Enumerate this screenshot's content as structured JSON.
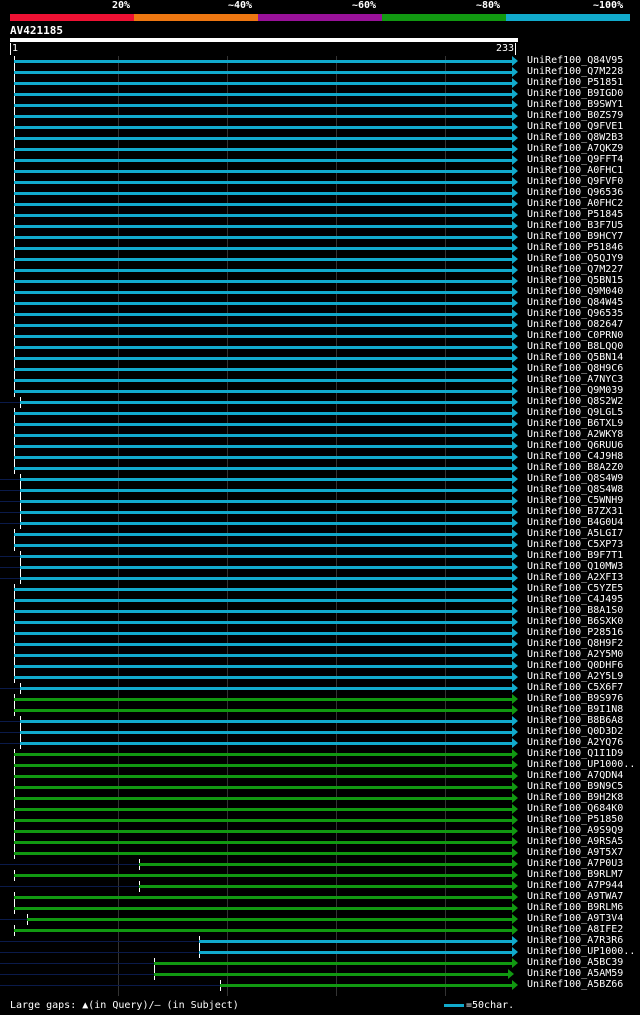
{
  "legend": {
    "labels": [
      "20%",
      "~40%",
      "~60%",
      "~80%",
      "~100%"
    ],
    "colors": [
      "#ee1133",
      "#ee7711",
      "#991199",
      "#119911",
      "#11aacc"
    ]
  },
  "query": {
    "title": "AV421185",
    "start": "1",
    "end": "233"
  },
  "hits": [
    {
      "name": "UniRef100_Q84V95",
      "color": "#11aacc",
      "start": 1,
      "end": 233
    },
    {
      "name": "UniRef100_Q7M228",
      "color": "#11aacc",
      "start": 1,
      "end": 233
    },
    {
      "name": "UniRef100_P51851",
      "color": "#11aacc",
      "start": 1,
      "end": 233
    },
    {
      "name": "UniRef100_B9IGD0",
      "color": "#11aacc",
      "start": 1,
      "end": 233
    },
    {
      "name": "UniRef100_B9SWY1",
      "color": "#11aacc",
      "start": 1,
      "end": 233
    },
    {
      "name": "UniRef100_B0ZS79",
      "color": "#11aacc",
      "start": 1,
      "end": 233
    },
    {
      "name": "UniRef100_Q9FVE1",
      "color": "#11aacc",
      "start": 1,
      "end": 233
    },
    {
      "name": "UniRef100_Q8W2B3",
      "color": "#11aacc",
      "start": 1,
      "end": 233
    },
    {
      "name": "UniRef100_A7QKZ9",
      "color": "#11aacc",
      "start": 1,
      "end": 233
    },
    {
      "name": "UniRef100_Q9FFT4",
      "color": "#11aacc",
      "start": 1,
      "end": 233
    },
    {
      "name": "UniRef100_A0FHC1",
      "color": "#11aacc",
      "start": 1,
      "end": 233
    },
    {
      "name": "UniRef100_Q9FVF0",
      "color": "#11aacc",
      "start": 1,
      "end": 233
    },
    {
      "name": "UniRef100_Q96536",
      "color": "#11aacc",
      "start": 1,
      "end": 233
    },
    {
      "name": "UniRef100_A0FHC2",
      "color": "#11aacc",
      "start": 1,
      "end": 233
    },
    {
      "name": "UniRef100_P51845",
      "color": "#11aacc",
      "start": 1,
      "end": 233
    },
    {
      "name": "UniRef100_B3F7U5",
      "color": "#11aacc",
      "start": 1,
      "end": 233
    },
    {
      "name": "UniRef100_B9HCY7",
      "color": "#11aacc",
      "start": 1,
      "end": 233
    },
    {
      "name": "UniRef100_P51846",
      "color": "#11aacc",
      "start": 1,
      "end": 233
    },
    {
      "name": "UniRef100_Q5QJY9",
      "color": "#11aacc",
      "start": 1,
      "end": 233
    },
    {
      "name": "UniRef100_Q7M227",
      "color": "#11aacc",
      "start": 1,
      "end": 233
    },
    {
      "name": "UniRef100_Q5BN15",
      "color": "#11aacc",
      "start": 1,
      "end": 233
    },
    {
      "name": "UniRef100_Q9M040",
      "color": "#11aacc",
      "start": 1,
      "end": 233
    },
    {
      "name": "UniRef100_Q84W45",
      "color": "#11aacc",
      "start": 1,
      "end": 233
    },
    {
      "name": "UniRef100_Q96535",
      "color": "#11aacc",
      "start": 1,
      "end": 233
    },
    {
      "name": "UniRef100_O82647",
      "color": "#11aacc",
      "start": 1,
      "end": 233
    },
    {
      "name": "UniRef100_C0PRN0",
      "color": "#11aacc",
      "start": 1,
      "end": 233
    },
    {
      "name": "UniRef100_B8LQQ0",
      "color": "#11aacc",
      "start": 1,
      "end": 233
    },
    {
      "name": "UniRef100_Q5BN14",
      "color": "#11aacc",
      "start": 1,
      "end": 233
    },
    {
      "name": "UniRef100_Q8H9C6",
      "color": "#11aacc",
      "start": 1,
      "end": 233
    },
    {
      "name": "UniRef100_A7NYC3",
      "color": "#11aacc",
      "start": 1,
      "end": 233
    },
    {
      "name": "UniRef100_Q9M039",
      "color": "#11aacc",
      "start": 1,
      "end": 233
    },
    {
      "name": "UniRef100_Q8S2W2",
      "color": "#11aacc",
      "start": 4,
      "end": 233
    },
    {
      "name": "UniRef100_Q9LGL5",
      "color": "#11aacc",
      "start": 1,
      "end": 233
    },
    {
      "name": "UniRef100_B6TXL9",
      "color": "#11aacc",
      "start": 1,
      "end": 233
    },
    {
      "name": "UniRef100_A2WKY8",
      "color": "#11aacc",
      "start": 1,
      "end": 233
    },
    {
      "name": "UniRef100_Q6RUU6",
      "color": "#11aacc",
      "start": 1,
      "end": 233
    },
    {
      "name": "UniRef100_C4J9H8",
      "color": "#11aacc",
      "start": 1,
      "end": 233
    },
    {
      "name": "UniRef100_B8A2Z0",
      "color": "#11aacc",
      "start": 1,
      "end": 233
    },
    {
      "name": "UniRef100_Q8S4W9",
      "color": "#11aacc",
      "start": 4,
      "end": 233
    },
    {
      "name": "UniRef100_Q8S4W8",
      "color": "#11aacc",
      "start": 4,
      "end": 233
    },
    {
      "name": "UniRef100_C5WNH9",
      "color": "#11aacc",
      "start": 4,
      "end": 233
    },
    {
      "name": "UniRef100_B7ZX31",
      "color": "#11aacc",
      "start": 4,
      "end": 233
    },
    {
      "name": "UniRef100_B4G0U4",
      "color": "#11aacc",
      "start": 4,
      "end": 233
    },
    {
      "name": "UniRef100_A5LGI7",
      "color": "#11aacc",
      "start": 1,
      "end": 233
    },
    {
      "name": "UniRef100_C5XP73",
      "color": "#11aacc",
      "start": 1,
      "end": 233
    },
    {
      "name": "UniRef100_B9F7T1",
      "color": "#11aacc",
      "start": 4,
      "end": 233
    },
    {
      "name": "UniRef100_Q10MW3",
      "color": "#11aacc",
      "start": 4,
      "end": 233
    },
    {
      "name": "UniRef100_A2XFI3",
      "color": "#11aacc",
      "start": 4,
      "end": 233
    },
    {
      "name": "UniRef100_C5YZE5",
      "color": "#11aacc",
      "start": 1,
      "end": 233
    },
    {
      "name": "UniRef100_C4J495",
      "color": "#11aacc",
      "start": 1,
      "end": 233
    },
    {
      "name": "UniRef100_B8A1S0",
      "color": "#11aacc",
      "start": 1,
      "end": 233
    },
    {
      "name": "UniRef100_B6SXK0",
      "color": "#11aacc",
      "start": 1,
      "end": 233
    },
    {
      "name": "UniRef100_P28516",
      "color": "#11aacc",
      "start": 1,
      "end": 233
    },
    {
      "name": "UniRef100_Q8H9F2",
      "color": "#11aacc",
      "start": 1,
      "end": 233
    },
    {
      "name": "UniRef100_A2Y5M0",
      "color": "#11aacc",
      "start": 1,
      "end": 233
    },
    {
      "name": "UniRef100_Q0DHF6",
      "color": "#11aacc",
      "start": 1,
      "end": 233
    },
    {
      "name": "UniRef100_A2Y5L9",
      "color": "#11aacc",
      "start": 1,
      "end": 233
    },
    {
      "name": "UniRef100_C5X6F7",
      "color": "#11aacc",
      "start": 4,
      "end": 233
    },
    {
      "name": "UniRef100_B9S976",
      "color": "#119911",
      "start": 1,
      "end": 233
    },
    {
      "name": "UniRef100_B9I1N8",
      "color": "#119911",
      "start": 1,
      "end": 233
    },
    {
      "name": "UniRef100_B8B6A8",
      "color": "#11aacc",
      "start": 4,
      "end": 233
    },
    {
      "name": "UniRef100_Q0D3D2",
      "color": "#11aacc",
      "start": 4,
      "end": 233
    },
    {
      "name": "UniRef100_A2YQ76",
      "color": "#11aacc",
      "start": 4,
      "end": 233
    },
    {
      "name": "UniRef100_Q1I1D9",
      "color": "#119911",
      "start": 1,
      "end": 233
    },
    {
      "name": "UniRef100_UP1000..",
      "color": "#119911",
      "start": 1,
      "end": 233
    },
    {
      "name": "UniRef100_A7QDN4",
      "color": "#119911",
      "start": 1,
      "end": 233
    },
    {
      "name": "UniRef100_B9N9C5",
      "color": "#119911",
      "start": 1,
      "end": 233
    },
    {
      "name": "UniRef100_B9H2K8",
      "color": "#119911",
      "start": 1,
      "end": 233
    },
    {
      "name": "UniRef100_Q684K0",
      "color": "#119911",
      "start": 1,
      "end": 233
    },
    {
      "name": "UniRef100_P51850",
      "color": "#119911",
      "start": 1,
      "end": 233
    },
    {
      "name": "UniRef100_A9S9Q9",
      "color": "#119911",
      "start": 1,
      "end": 233
    },
    {
      "name": "UniRef100_A9RSA5",
      "color": "#119911",
      "start": 1,
      "end": 233
    },
    {
      "name": "UniRef100_A9T5X7",
      "color": "#119911",
      "start": 1,
      "end": 233
    },
    {
      "name": "UniRef100_A7P0U3",
      "color": "#119911",
      "start": 59,
      "end": 233
    },
    {
      "name": "UniRef100_B9RLM7",
      "color": "#119911",
      "start": 1,
      "end": 233
    },
    {
      "name": "UniRef100_A7P944",
      "color": "#119911",
      "start": 59,
      "end": 233
    },
    {
      "name": "UniRef100_A9TWA7",
      "color": "#119911",
      "start": 1,
      "end": 233
    },
    {
      "name": "UniRef100_B9RLM6",
      "color": "#119911",
      "start": 1,
      "end": 233
    },
    {
      "name": "UniRef100_A9T3V4",
      "color": "#119911",
      "start": 7,
      "end": 233
    },
    {
      "name": "UniRef100_A8IFE2",
      "color": "#119911",
      "start": 1,
      "end": 233
    },
    {
      "name": "UniRef100_A7R3R6",
      "color": "#11aacc",
      "start": 87,
      "end": 233
    },
    {
      "name": "UniRef100_UP1000..",
      "color": "#11aacc",
      "start": 87,
      "end": 233
    },
    {
      "name": "UniRef100_A5BC39",
      "color": "#119911",
      "start": 66,
      "end": 233
    },
    {
      "name": "UniRef100_A5AM59",
      "color": "#119911",
      "start": 66,
      "end": 231
    },
    {
      "name": "UniRef100_A5BZ66",
      "color": "#119911",
      "start": 97,
      "end": 233
    }
  ],
  "footer": {
    "text": "Large gaps: ▲(in Query)/– (in Subject)",
    "key_color": "#11aacc",
    "key_label": "=50char."
  }
}
